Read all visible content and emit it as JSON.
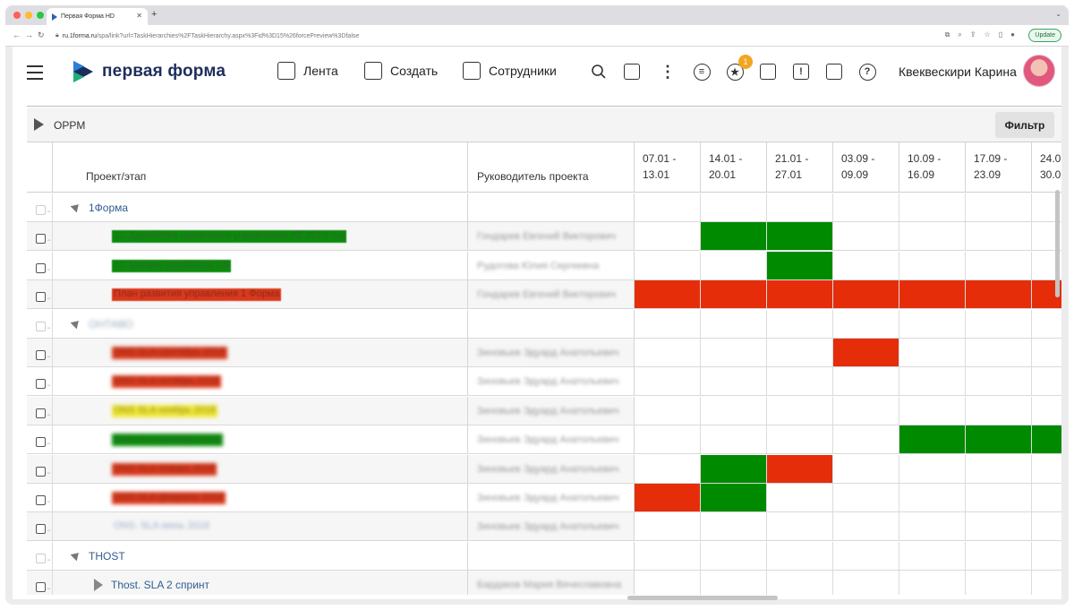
{
  "browser": {
    "tab_title": "Первая Форма HD",
    "url_host": "ru.1forma.ru",
    "url_path": "/spa/link?url=TaskHierarchies%2FTaskHierarchy.aspx%3Fid%3D15%26forcePreview%3Dfalse",
    "update_label": "Update"
  },
  "header": {
    "logo_text": "первая форма",
    "nav": [
      {
        "label": "Лента",
        "icon": "feed-icon"
      },
      {
        "label": "Создать",
        "icon": "create-icon"
      },
      {
        "label": "Сотрудники",
        "icon": "employees-icon"
      }
    ],
    "notification_count": "1",
    "user_name": "Квеквескири Карина"
  },
  "toolbar": {
    "title": "OPPM",
    "filter_label": "Фильтр"
  },
  "grid": {
    "col_project": "Проект/этап",
    "col_manager": "Руководитель проекта",
    "weeks": [
      {
        "a": "07.01 -",
        "b": "13.01"
      },
      {
        "a": "14.01 -",
        "b": "20.01"
      },
      {
        "a": "21.01 -",
        "b": "27.01"
      },
      {
        "a": "03.09 -",
        "b": "09.09"
      },
      {
        "a": "10.09 -",
        "b": "16.09"
      },
      {
        "a": "17.09 -",
        "b": "23.09"
      },
      {
        "a": "24.0",
        "b": "30.0"
      }
    ],
    "rows": [
      {
        "type": "group",
        "name": "1Форма"
      },
      {
        "type": "task",
        "name": "1С Доработка проектного управления ХВ 2019 год",
        "manager": "Гондарев Евгений Викторович",
        "color": "g",
        "cells": [
          "",
          "g",
          "g",
          "",
          "",
          "",
          ""
        ]
      },
      {
        "type": "task",
        "name": "1С Мелкие доработки ХВ",
        "manager": "Рудогова Юлия Сергеевна",
        "color": "g",
        "cells": [
          "",
          "",
          "g",
          "",
          "",
          "",
          ""
        ]
      },
      {
        "type": "task",
        "name": "План развития управления 1 Форма",
        "manager": "Гондарев Евгений Викторович",
        "color": "r",
        "cells": [
          "r",
          "r",
          "r",
          "r",
          "r",
          "r",
          "r"
        ]
      },
      {
        "type": "group",
        "name": "ОНТАВО"
      },
      {
        "type": "task",
        "name": "ONS SLA сентябрь 2018",
        "manager": "Зиновьев Эдуард Анатольевич",
        "color": "r",
        "cells": [
          "",
          "",
          "",
          "r",
          "",
          "",
          ""
        ]
      },
      {
        "type": "task",
        "name": "ONS SLA октябрь 2018",
        "manager": "Зиновьев Эдуард Анатольевич",
        "color": "r",
        "cells": [
          "",
          "",
          "",
          "",
          "",
          "",
          ""
        ]
      },
      {
        "type": "task",
        "name": "ONS SLA ноябрь 2018",
        "manager": "Зиновьев Эдуард Анатольевич",
        "color": "y",
        "cells": [
          "",
          "",
          "",
          "",
          "",
          "",
          ""
        ]
      },
      {
        "type": "task",
        "name": "ONS SLA декабрь 2018",
        "manager": "Зиновьев Эдуард Анатольевич",
        "color": "g",
        "cells": [
          "",
          "",
          "",
          "",
          "g",
          "g",
          "g"
        ]
      },
      {
        "type": "task",
        "name": "ONS SLA январь 2019",
        "manager": "Зиновьев Эдуард Анатольевич",
        "color": "r",
        "cells": [
          "",
          "g",
          "r",
          "",
          "",
          "",
          ""
        ]
      },
      {
        "type": "task",
        "name": "ONS SLA февраль 2019",
        "manager": "Зиновьев Эдуард Анатольевич",
        "color": "r",
        "cells": [
          "r",
          "g",
          "",
          "",
          "",
          "",
          ""
        ]
      },
      {
        "type": "task",
        "name": "ONS. SLA июнь 2018",
        "manager": "Зиновьев Эдуард Анатольевич",
        "color": "plain",
        "cells": [
          "",
          "",
          "",
          "",
          "",
          "",
          ""
        ]
      },
      {
        "type": "group",
        "name": "THOST"
      },
      {
        "type": "subgroup",
        "name": "Thost. SLA 2 спринт",
        "manager": "Бардаков Мария Вячеславовна",
        "cells": [
          "",
          "",
          "",
          "",
          "",
          "",
          ""
        ]
      }
    ]
  }
}
